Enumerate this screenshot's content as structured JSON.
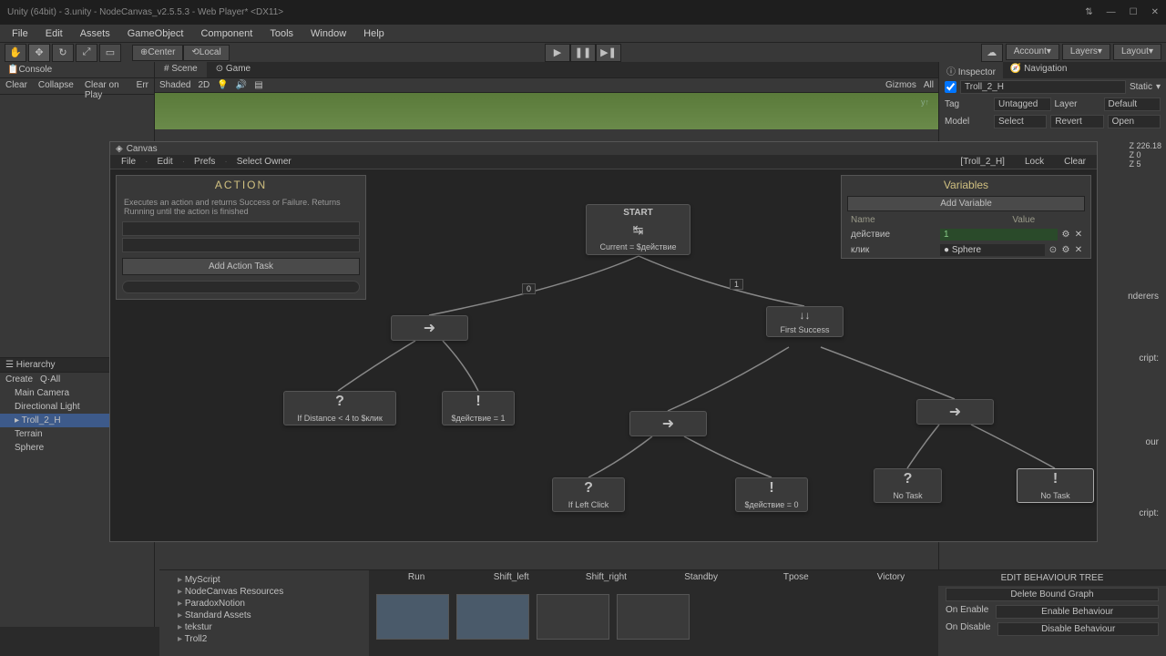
{
  "window": {
    "title": "Unity (64bit) - 3.unity - NodeCanvas_v2.5.5.3 - Web Player* <DX11>"
  },
  "menubar": [
    "File",
    "Edit",
    "Assets",
    "GameObject",
    "Component",
    "Tools",
    "Window",
    "Help"
  ],
  "toolbar": {
    "center": "Center",
    "local": "Local",
    "account": "Account",
    "layers": "Layers",
    "layout": "Layout"
  },
  "console": {
    "tab": "Console",
    "clear": "Clear",
    "collapse": "Collapse",
    "clearOnPlay": "Clear on Play",
    "err": "Err"
  },
  "scene": {
    "sceneTab": "Scene",
    "gameTab": "Game",
    "shaded": "Shaded",
    "mode2d": "2D",
    "gizmos": "Gizmos",
    "all": "All"
  },
  "hierarchy": {
    "title": "Hierarchy",
    "create": "Create",
    "qall": "Q·All",
    "items": [
      "Main Camera",
      "Directional Light",
      "Troll_2_H",
      "Terrain",
      "Sphere"
    ]
  },
  "canvas": {
    "title": "Canvas",
    "menu": [
      "File",
      "Edit",
      "Prefs",
      "Select Owner"
    ],
    "owner": "[Troll_2_H]",
    "lock": "Lock",
    "clear": "Clear"
  },
  "action": {
    "title": "ACTION",
    "desc": "Executes an action and returns Success or Failure. Returns Running until the action is finished",
    "addTask": "Add Action Task"
  },
  "variables": {
    "title": "Variables",
    "add": "Add Variable",
    "nameCol": "Name",
    "valueCol": "Value",
    "rows": [
      {
        "name": "действие",
        "value": "1"
      },
      {
        "name": "клик",
        "value": "Sphere"
      }
    ]
  },
  "nodes": {
    "start": {
      "title": "START",
      "sub": "Current = $действие"
    },
    "firstSuccess": "First Success",
    "cond1": "If Distance < 4 to $клик",
    "act1": "$действие = 1",
    "cond2": "If Left Click",
    "act2": "$действие = 0",
    "cond3": "No Task",
    "act3": "No Task",
    "conn0": "0",
    "conn1": "1"
  },
  "inspector": {
    "tab1": "Inspector",
    "tab2": "Navigation",
    "objName": "Troll_2_H",
    "static": "Static",
    "tag": "Tag",
    "tagVal": "Untagged",
    "layer": "Layer",
    "layerVal": "Default",
    "model": "Model",
    "select": "Select",
    "revert": "Revert",
    "open": "Open"
  },
  "transform": {
    "z1": "Z 226.18",
    "z2": "Z 0",
    "z3": "Z 5"
  },
  "misc": {
    "nderers": "nderers",
    "cript": "cript:",
    "cript2": "cript:",
    "our": "our"
  },
  "project": {
    "items": [
      "MyScript",
      "NodeCanvas Resources",
      "ParadoxNotion",
      "Standard Assets",
      "tekstur",
      "Troll2"
    ]
  },
  "animator": {
    "clips": [
      "Run",
      "Shift_left",
      "Shift_right",
      "Standby",
      "Tpose",
      "Victory"
    ]
  },
  "bottomRight": {
    "title": "EDIT BEHAVIOUR TREE",
    "delete": "Delete Bound Graph",
    "onEnable": "On Enable",
    "onDisable": "On Disable",
    "enable": "Enable Behaviour",
    "disable": "Disable Behaviour"
  }
}
